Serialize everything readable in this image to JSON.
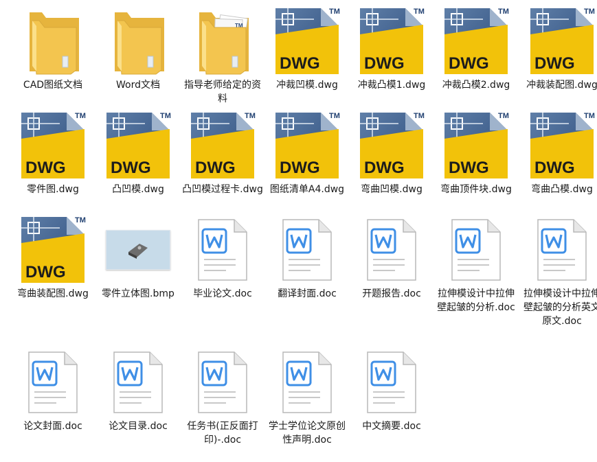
{
  "files": [
    {
      "type": "folder",
      "name": "CAD图纸文档"
    },
    {
      "type": "folder",
      "name": "Word文档"
    },
    {
      "type": "folder-docs",
      "name": "指导老师给定的资料"
    },
    {
      "type": "dwg",
      "name": "冲裁凹模.dwg"
    },
    {
      "type": "dwg",
      "name": "冲裁凸模1.dwg"
    },
    {
      "type": "dwg",
      "name": "冲裁凸模2.dwg"
    },
    {
      "type": "dwg",
      "name": "冲裁装配图.dwg"
    },
    {
      "type": "dwg",
      "name": "零件图.dwg"
    },
    {
      "type": "dwg",
      "name": "凸凹模.dwg"
    },
    {
      "type": "dwg",
      "name": "凸凹模过程卡.dwg"
    },
    {
      "type": "dwg",
      "name": "图纸清单A4.dwg"
    },
    {
      "type": "dwg",
      "name": "弯曲凹模.dwg"
    },
    {
      "type": "dwg",
      "name": "弯曲顶件块.dwg"
    },
    {
      "type": "dwg",
      "name": "弯曲凸模.dwg"
    },
    {
      "type": "dwg",
      "name": "弯曲装配图.dwg"
    },
    {
      "type": "bmp",
      "name": "零件立体图.bmp"
    },
    {
      "type": "doc",
      "name": "毕业论文.doc"
    },
    {
      "type": "doc",
      "name": "翻译封面.doc"
    },
    {
      "type": "doc",
      "name": "开题报告.doc"
    },
    {
      "type": "doc",
      "name": "拉伸模设计中拉伸壁起皱的分析.doc"
    },
    {
      "type": "doc",
      "name": "拉伸模设计中拉伸壁起皱的分析英文原文.doc"
    },
    {
      "type": "doc",
      "name": "论文封面.doc"
    },
    {
      "type": "doc",
      "name": "论文目录.doc"
    },
    {
      "type": "doc",
      "name": "任务书(正反面打印)-.doc"
    },
    {
      "type": "doc",
      "name": "学士学位论文原创性声明.doc"
    },
    {
      "type": "doc",
      "name": "中文摘要.doc"
    }
  ],
  "icons": {
    "dwg_text": "DWG",
    "dwg_tm": "TM",
    "doc_letter": "W"
  },
  "colors": {
    "folder": "#f3c54f",
    "dwg_blue": "#2a4a7a",
    "dwg_gold": "#f2c20a",
    "doc_blue": "#3f8fe6"
  }
}
